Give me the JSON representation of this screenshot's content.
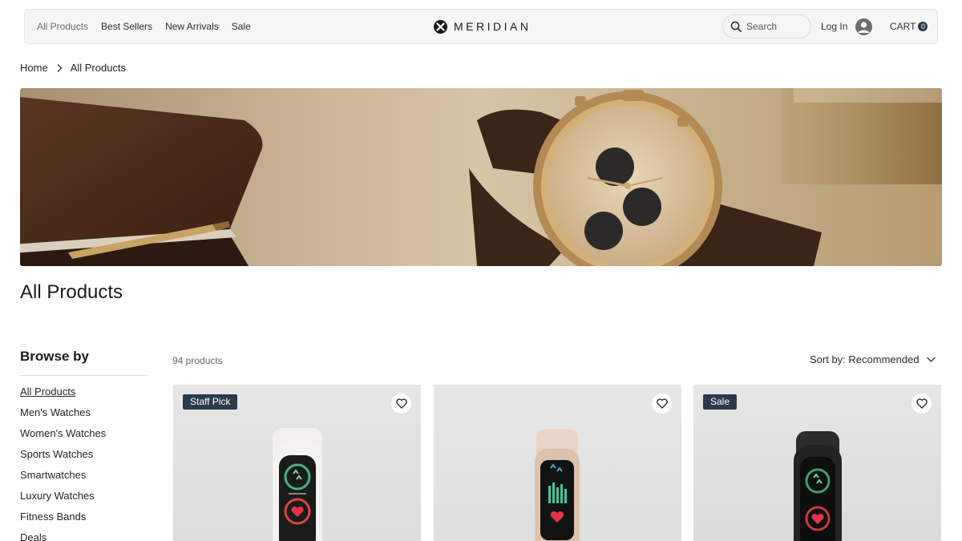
{
  "header": {
    "nav": [
      "All Products",
      "Best Sellers",
      "New Arrivals",
      "Sale"
    ],
    "brand": "MERIDIAN",
    "search_placeholder": "Search",
    "login": "Log In",
    "cart_label": "CART",
    "cart_count": "0"
  },
  "breadcrumb": {
    "home": "Home",
    "current": "All Products"
  },
  "page": {
    "title": "All Products"
  },
  "sidebar": {
    "title": "Browse by",
    "items": [
      "All Products",
      "Men's Watches",
      "Women's Watches",
      "Sports Watches",
      "Smartwatches",
      "Luxury Watches",
      "Fitness Bands",
      "Deals"
    ],
    "active_index": 0
  },
  "toolbar": {
    "count": "94 products",
    "sort": "Sort by: Recommended"
  },
  "products": [
    {
      "badge": "Staff Pick",
      "strap_color": "#f2f0ec"
    },
    {
      "badge": "",
      "strap_color": "#e9d3c6"
    },
    {
      "badge": "Sale",
      "strap_color": "#2c2c2c"
    }
  ],
  "colors": {
    "accent": "#2b3a4a",
    "header_bg": "#f6f6f6"
  },
  "icons": {
    "brand": "x-logo-icon",
    "search": "search-icon",
    "avatar": "user-avatar-icon",
    "breadcrumb_sep": "chevron-right-icon",
    "sort": "chevron-down-icon",
    "wishlist": "heart-outline-icon"
  }
}
